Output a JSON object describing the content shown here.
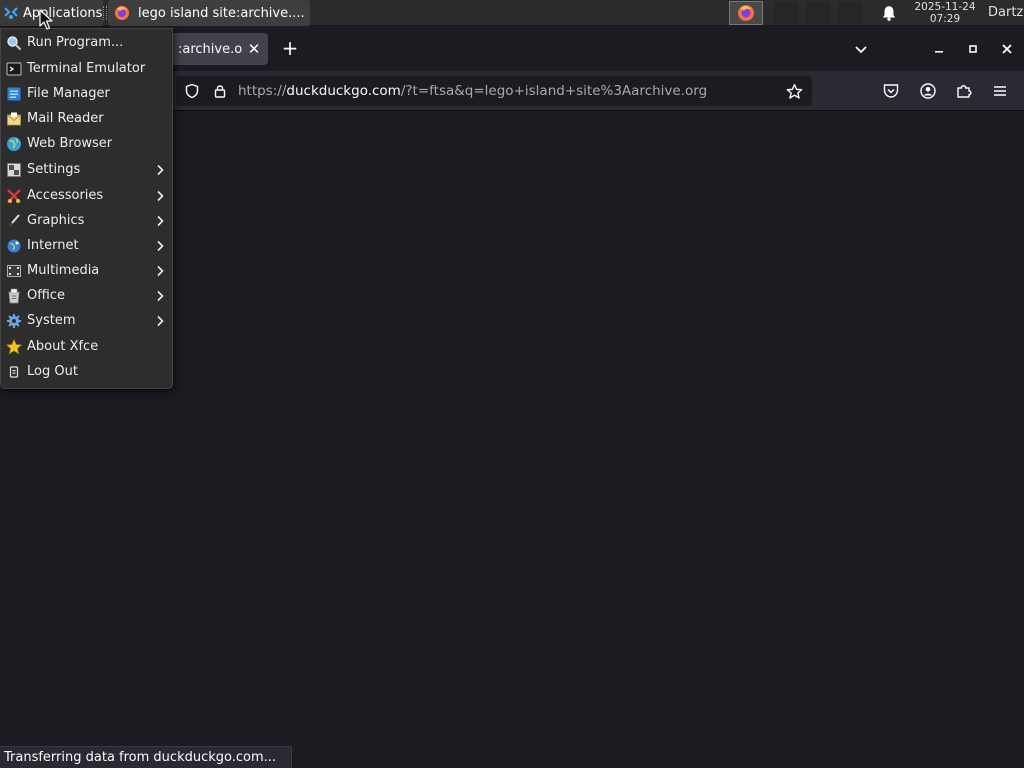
{
  "panel": {
    "applications_label": "Applications",
    "task_title": "lego island site:archive....",
    "clock_date": "2025-11-24",
    "clock_time": "07:29",
    "user": "Dartz"
  },
  "browser": {
    "tab_title": ":archive.o",
    "url_host_prefix": "https://",
    "url_domain": "duckduckgo.com",
    "url_rest": "/?t=ftsa&q=lego+island+site%3Aarchive.org",
    "status_text": "Transferring data from duckduckgo.com..."
  },
  "menu": {
    "items": [
      {
        "label": "Run Program...",
        "icon": "run-program-icon",
        "submenu": false
      },
      {
        "label": "Terminal Emulator",
        "icon": "terminal-icon",
        "submenu": false
      },
      {
        "label": "File Manager",
        "icon": "file-manager-icon",
        "submenu": false
      },
      {
        "label": "Mail Reader",
        "icon": "mail-reader-icon",
        "submenu": false
      },
      {
        "label": "Web Browser",
        "icon": "web-browser-icon",
        "submenu": false
      },
      {
        "label": "Settings",
        "icon": "settings-icon",
        "submenu": true
      },
      {
        "label": "Accessories",
        "icon": "accessories-icon",
        "submenu": true
      },
      {
        "label": "Graphics",
        "icon": "graphics-icon",
        "submenu": true
      },
      {
        "label": "Internet",
        "icon": "internet-icon",
        "submenu": true
      },
      {
        "label": "Multimedia",
        "icon": "multimedia-icon",
        "submenu": true
      },
      {
        "label": "Office",
        "icon": "office-icon",
        "submenu": true
      },
      {
        "label": "System",
        "icon": "system-icon",
        "submenu": true
      },
      {
        "label": "About Xfce",
        "icon": "about-xfce-icon",
        "submenu": false
      },
      {
        "label": "Log Out",
        "icon": "log-out-icon",
        "submenu": false
      }
    ]
  },
  "colors": {
    "panel_bg": "#2b2b2b",
    "menu_bg": "#2d2d2d",
    "browser_bg": "#1c1b22",
    "toolbar_bg": "#2b2a33",
    "active_tab_bg": "#42414d"
  }
}
